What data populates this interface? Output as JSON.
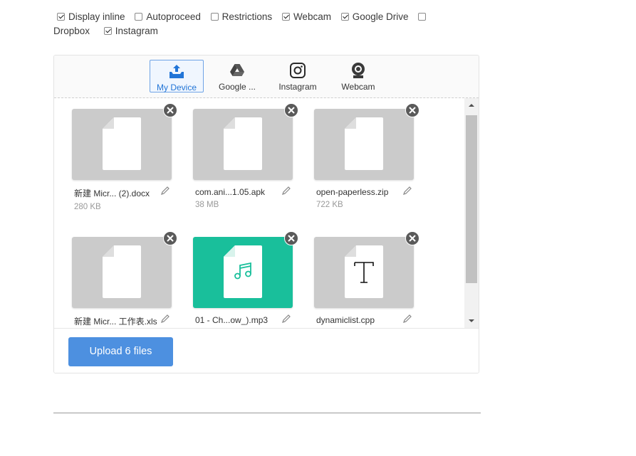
{
  "options": [
    {
      "label": "Display inline",
      "checked": true
    },
    {
      "label": "Autoproceed",
      "checked": false
    },
    {
      "label": "Restrictions",
      "checked": false
    },
    {
      "label": "Webcam",
      "checked": true
    },
    {
      "label": "Google Drive",
      "checked": true
    },
    {
      "label": "Dropbox",
      "checked": false
    },
    {
      "label": "Instagram",
      "checked": true
    }
  ],
  "tabs": [
    {
      "label": "My Device",
      "icon": "my-device-icon",
      "active": true
    },
    {
      "label": "Google ...",
      "icon": "google-drive-icon",
      "active": false
    },
    {
      "label": "Instagram",
      "icon": "instagram-icon",
      "active": false
    },
    {
      "label": "Webcam",
      "icon": "webcam-icon",
      "active": false
    }
  ],
  "files": [
    {
      "name": "新建 Micr... (2).docx",
      "size": "280 KB",
      "type": "document"
    },
    {
      "name": "com.ani...1.05.apk",
      "size": "38 MB",
      "type": "document"
    },
    {
      "name": "open-paperless.zip",
      "size": "722 KB",
      "type": "document"
    },
    {
      "name": "新建 Micr... 工作表.xls",
      "size": "",
      "type": "document"
    },
    {
      "name": "01 - Ch...ow_).mp3",
      "size": "",
      "type": "audio"
    },
    {
      "name": "dynamiclist.cpp",
      "size": "",
      "type": "text"
    }
  ],
  "upload_button": "Upload 6 files",
  "colors": {
    "accent": "#4d90e0",
    "audio_bg": "#19bf9b",
    "thumb_bg": "#cbcbcb"
  }
}
